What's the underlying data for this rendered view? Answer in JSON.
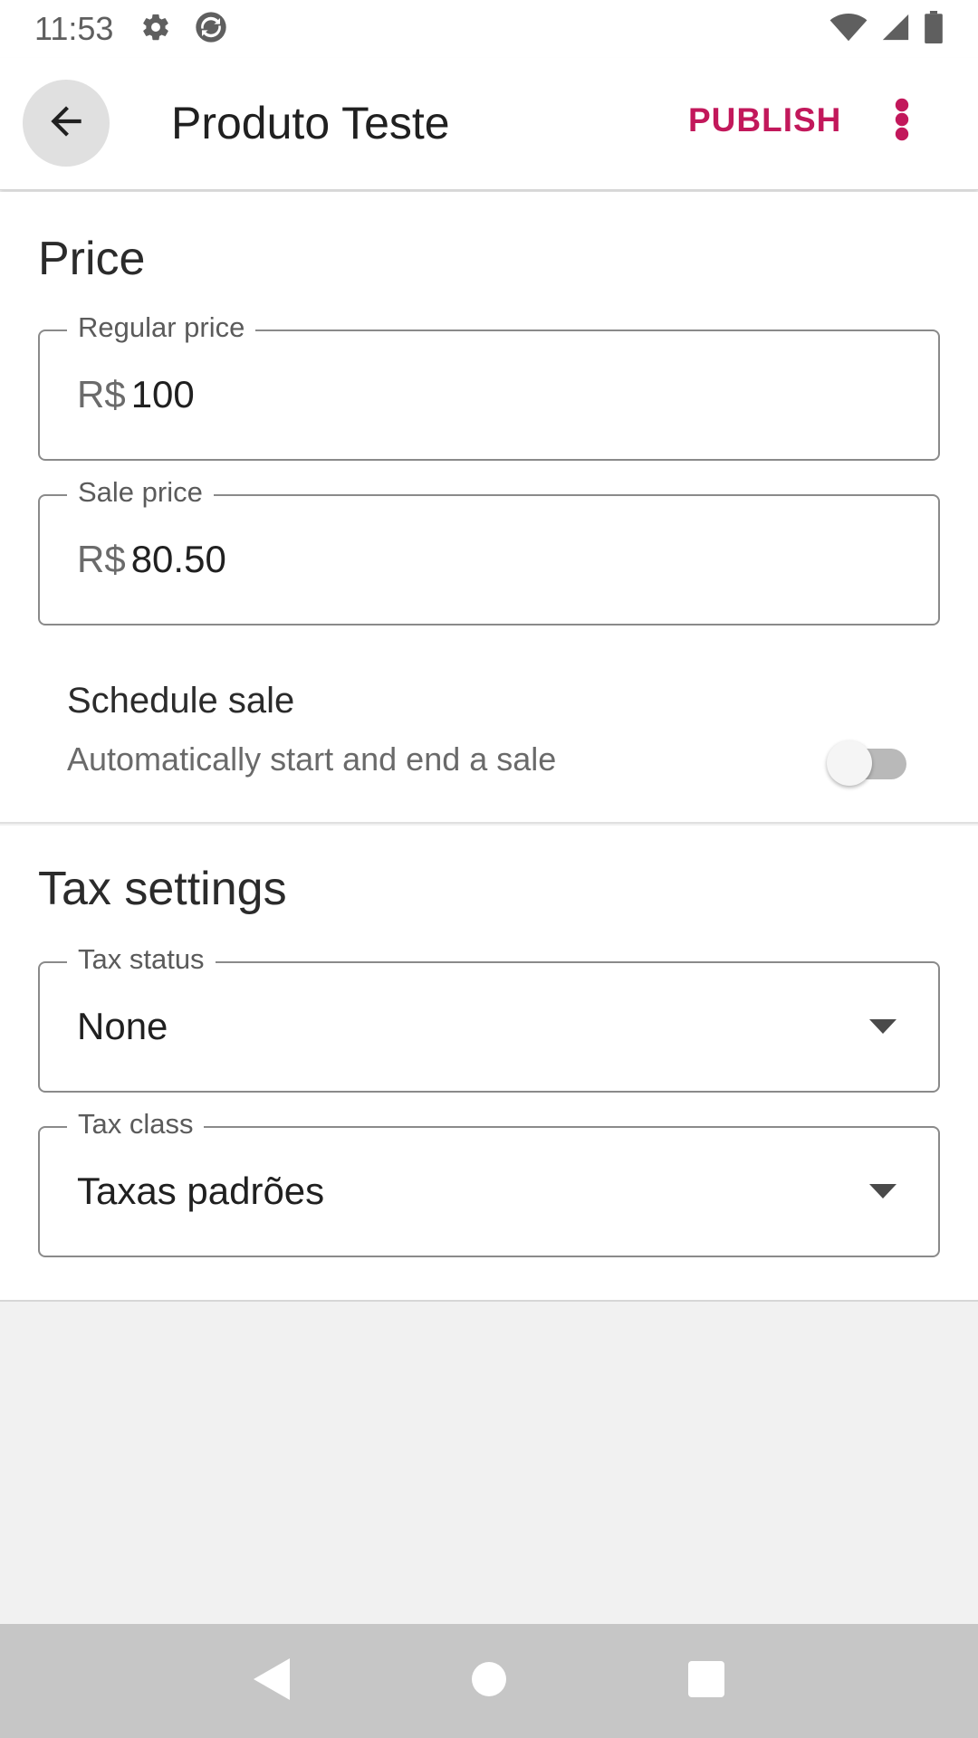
{
  "statusbar": {
    "time": "11:53",
    "icons_left": [
      "gear-icon",
      "sync-icon"
    ],
    "icons_right": [
      "wifi-icon",
      "signal-icon",
      "battery-icon"
    ]
  },
  "appbar": {
    "back_icon": "arrow-left-icon",
    "title": "Produto Teste",
    "publish_label": "PUBLISH",
    "overflow_icon": "more-vert-icon"
  },
  "price": {
    "section_title": "Price",
    "regular_price": {
      "label": "Regular price",
      "prefix": "R$",
      "value": "100"
    },
    "sale_price": {
      "label": "Sale price",
      "prefix": "R$",
      "value": "80.50"
    },
    "schedule": {
      "title": "Schedule sale",
      "subtitle": "Automatically start and end a sale",
      "enabled": false
    }
  },
  "tax": {
    "section_title": "Tax settings",
    "tax_status": {
      "label": "Tax status",
      "value": "None"
    },
    "tax_class": {
      "label": "Tax class",
      "value": "Taxas padrões"
    }
  },
  "navbar": {
    "icons": [
      "nav-back-icon",
      "nav-home-icon",
      "nav-recents-icon"
    ]
  },
  "colors": {
    "accent": "#c2185b",
    "surface": "#ffffff",
    "background": "#f1f1f1",
    "navbar": "#c6c6c6"
  }
}
